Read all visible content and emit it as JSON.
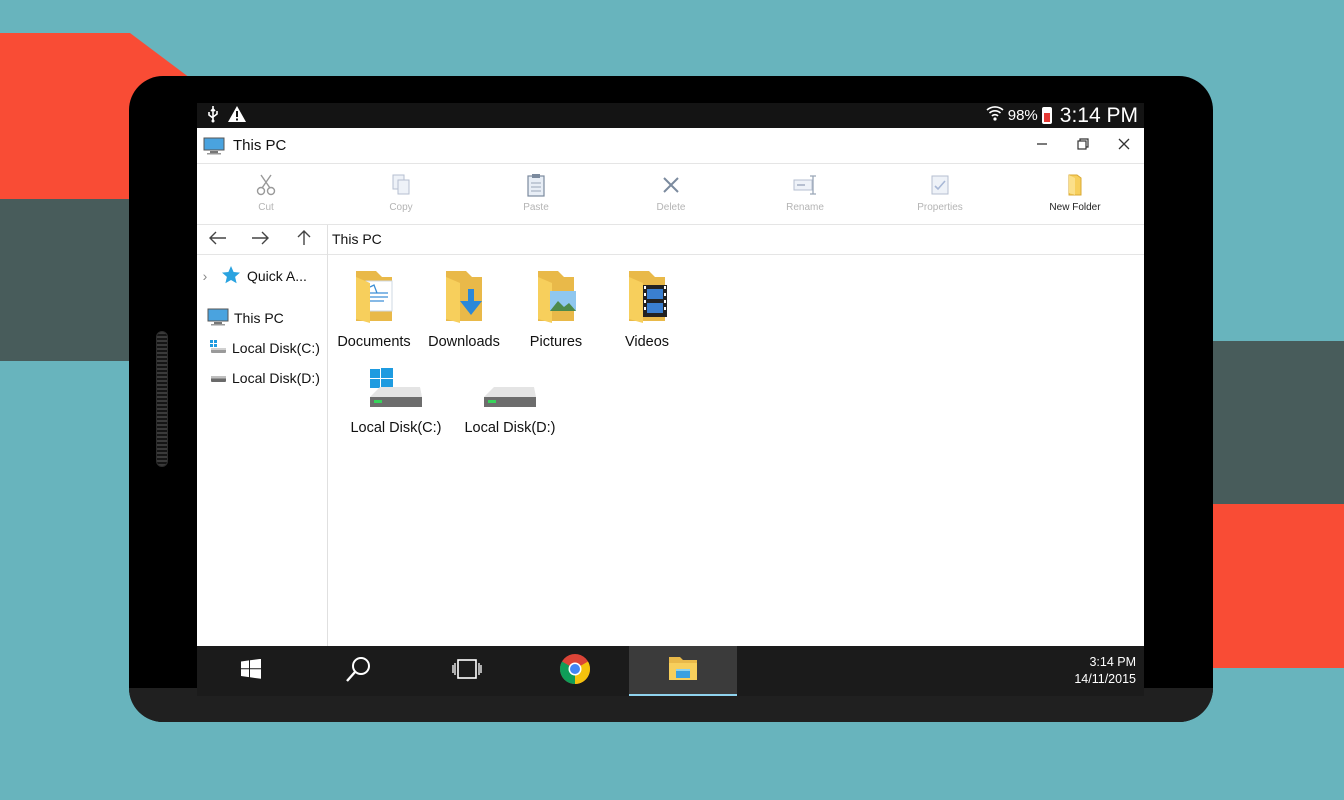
{
  "status_bar": {
    "battery_percent": "98%",
    "time": "3:14 PM",
    "icons": [
      "usb-icon",
      "warning-icon",
      "wifi-icon",
      "battery-icon"
    ]
  },
  "window": {
    "title": "This PC",
    "controls": [
      "minimize-icon",
      "restore-icon",
      "close-icon"
    ]
  },
  "ribbon": {
    "cut": "Cut",
    "copy": "Copy",
    "paste": "Paste",
    "delete": "Delete",
    "rename": "Rename",
    "properties": "Properties",
    "new_folder": "New Folder"
  },
  "address": {
    "path": "This PC"
  },
  "sidebar": {
    "items": [
      {
        "label": "Quick A..."
      },
      {
        "label": "This PC"
      },
      {
        "label": "Local Disk(C:)"
      },
      {
        "label": "Local Disk(D:)"
      }
    ]
  },
  "content": {
    "folders": [
      {
        "label": "Documents"
      },
      {
        "label": "Downloads"
      },
      {
        "label": "Pictures"
      },
      {
        "label": "Videos"
      }
    ],
    "drives": [
      {
        "label": "Local Disk(C:)"
      },
      {
        "label": "Local Disk(D:)"
      }
    ]
  },
  "taskbar": {
    "time": "3:14 PM",
    "date": "14/11/2015",
    "apps": [
      "start-icon",
      "search-icon",
      "task-view-icon",
      "chrome-icon",
      "file-explorer-icon"
    ]
  },
  "colors": {
    "background": "#68b4bd",
    "accent_red": "#f94c35",
    "accent_dark": "#485c5b",
    "taskbar": "#1b1b1b",
    "folder_yellow": "#f7cf5c"
  }
}
